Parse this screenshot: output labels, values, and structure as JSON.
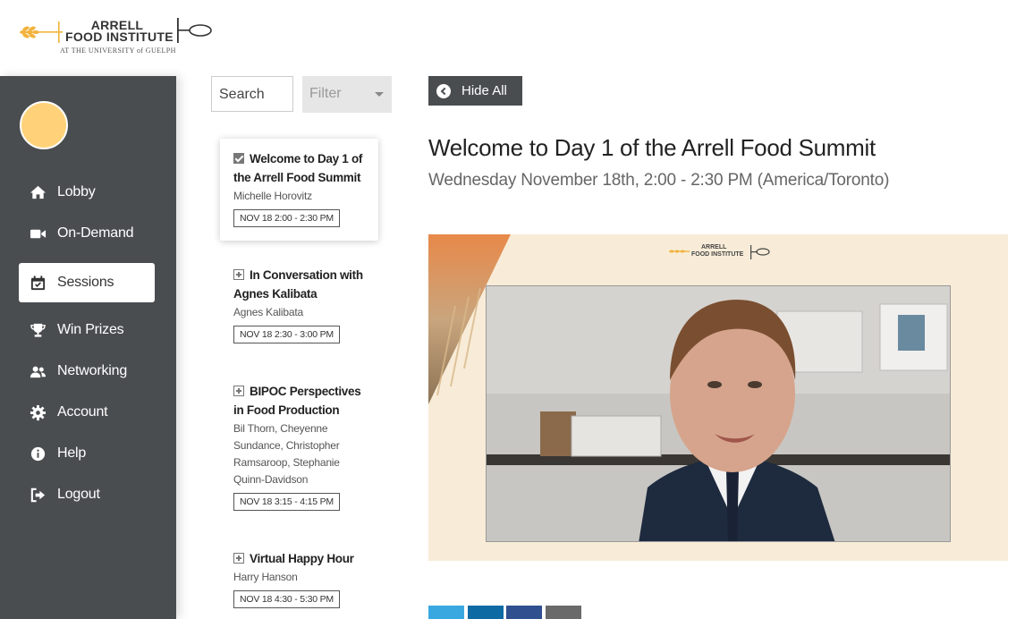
{
  "logo": {
    "line1": "ARRELL",
    "line2": "FOOD INSTITUTE",
    "line3": "AT THE UNIVERSITY of GUELPH"
  },
  "colors": {
    "sidebar": "#4a4d50",
    "avatar": "#ffd27a",
    "brand_gold": "#f2b33d",
    "twitter": "#3aa8e0",
    "linkedin": "#0d6aa3",
    "facebook": "#2f4f8f",
    "email": "#6a6a6a"
  },
  "nav": {
    "items": [
      {
        "label": "Lobby",
        "icon": "home-icon"
      },
      {
        "label": "On-Demand",
        "icon": "video-camera-icon"
      },
      {
        "label": "Sessions",
        "icon": "calendar-icon",
        "active": true
      },
      {
        "label": "Win Prizes",
        "icon": "trophy-icon"
      },
      {
        "label": "Networking",
        "icon": "users-icon"
      },
      {
        "label": "Account",
        "icon": "gear-icon"
      },
      {
        "label": "Help",
        "icon": "info-icon"
      },
      {
        "label": "Logout",
        "icon": "logout-icon"
      }
    ]
  },
  "search": {
    "label": "Search"
  },
  "filter": {
    "label": "Filter"
  },
  "sessions": [
    {
      "title_line1": "Welcome to Day 1 of",
      "title_line2": "the Arrell Food Summit",
      "speakers": [
        "Michelle Horovitz"
      ],
      "time": "NOV 18 2:00 - 2:30 PM",
      "selected": true
    },
    {
      "title_line1": "In Conversation with",
      "title_line2": "Agnes Kalibata",
      "speakers": [
        "Agnes Kalibata"
      ],
      "time": "NOV 18 2:30 - 3:00 PM"
    },
    {
      "title_line1": "BIPOC Perspectives",
      "title_line2": "in Food Production",
      "speakers": [
        "Bil Thorn, Cheyenne",
        "Sundance, Christopher",
        "Ramsaroop, Stephanie",
        "Quinn-Davidson"
      ],
      "time": "NOV 18 3:15 - 4:15 PM"
    },
    {
      "title_line1": "Virtual Happy Hour",
      "title_line2": "",
      "speakers": [
        "Harry Hanson"
      ],
      "time": "NOV 18 4:30 - 5:30 PM"
    }
  ],
  "main": {
    "hide_button": "Hide All",
    "title": "Welcome to Day 1 of the Arrell Food Summit",
    "subtitle": "Wednesday November 18th, 2:00 - 2:30 PM (America/Toronto)"
  },
  "video_logo": {
    "line1": "ARRELL",
    "line2": "FOOD INSTITUTE"
  },
  "share": [
    "twitter-icon",
    "linkedin-icon",
    "facebook-icon",
    "email-icon"
  ]
}
